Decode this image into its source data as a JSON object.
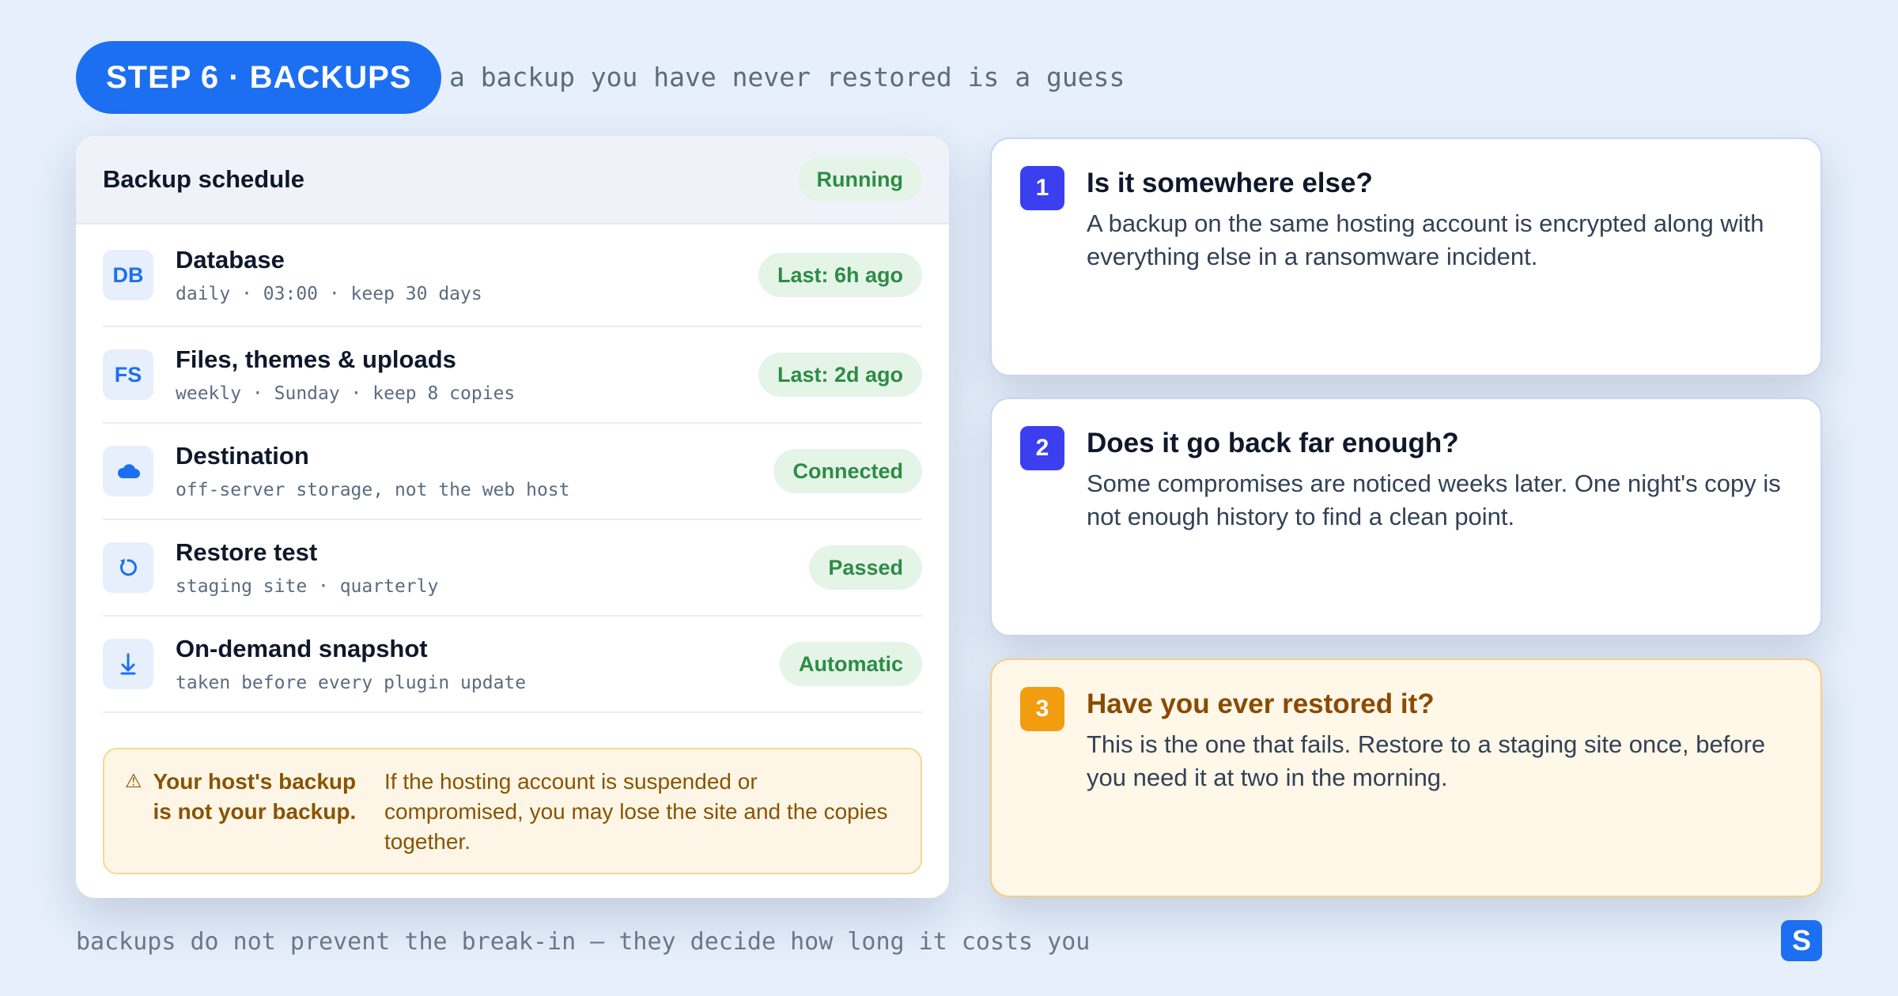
{
  "header": {
    "step_label": "STEP 6 · BACKUPS",
    "tagline": "a backup you have never restored is a guess"
  },
  "schedule": {
    "title": "Backup schedule",
    "status": "Running",
    "rows": [
      {
        "icon": "DB",
        "title": "Database",
        "sub": "daily · 03:00 · keep 30 days",
        "badge": "Last: 6h ago"
      },
      {
        "icon": "FS",
        "title": "Files, themes & uploads",
        "sub": "weekly · Sunday · keep 8 copies",
        "badge": "Last: 2d ago"
      },
      {
        "icon": "cloud-icon",
        "title": "Destination",
        "sub": "off-server storage, not the web host",
        "badge": "Connected"
      },
      {
        "icon": "restore-icon",
        "title": "Restore test",
        "sub": "staging site · quarterly",
        "badge": "Passed"
      },
      {
        "icon": "download-icon",
        "title": "On-demand snapshot",
        "sub": "taken before every plugin update",
        "badge": "Automatic"
      }
    ],
    "warning": {
      "label": "Your host's backup is not your backup.",
      "text": "If the hosting account is suspended or compromised, you may lose the site and the copies together."
    }
  },
  "questions": [
    {
      "num": "1",
      "title": "Is it somewhere else?",
      "text": "A backup on the same hosting account is encrypted along with everything else in a ransomware incident."
    },
    {
      "num": "2",
      "title": "Does it go back far enough?",
      "text": "Some compromises are noticed weeks later. One night's copy is not enough history to find a clean point."
    },
    {
      "num": "3",
      "title": "Have you ever restored it?",
      "text": "This is the one that fails. Restore to a staging site once, before you need it at two in the morning."
    }
  ],
  "footer": {
    "text": "backups do not prevent the break-in — they decide how long it costs you",
    "logo": "S"
  },
  "colors": {
    "accent": "#1d6ff2",
    "success_bg": "#e4f5e8",
    "success_text": "#2e8b45",
    "warning_bg": "#fdf6e6",
    "warning_text": "#8a5300",
    "question_num": "#3b3ff0",
    "question_num_amber": "#f29c10"
  }
}
